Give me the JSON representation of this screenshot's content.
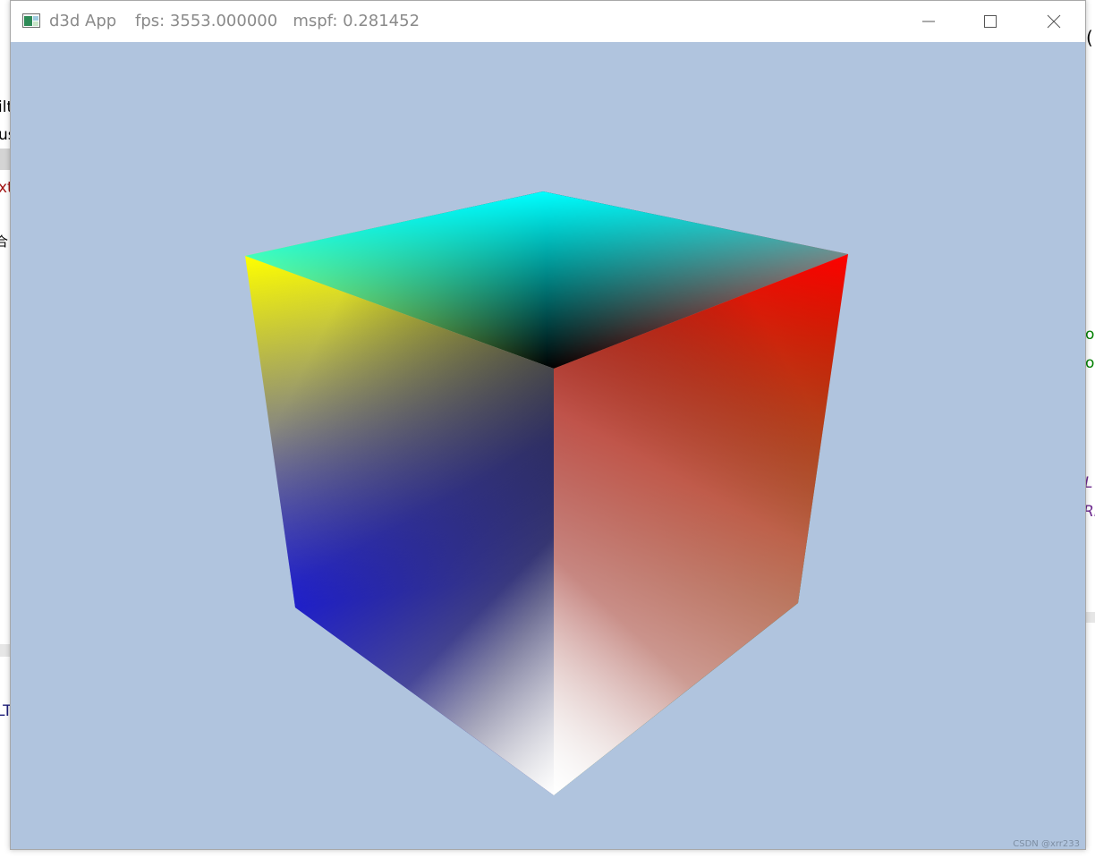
{
  "window": {
    "app_name": "d3d App",
    "stats": "fps: 3553.000000   mspf: 0.281452",
    "minimize_icon": "minimize-icon",
    "maximize_icon": "maximize-icon",
    "close_icon": "close-icon"
  },
  "scene": {
    "background_color": "#b0c4de",
    "object": "cube",
    "vertex_colors": {
      "top_back": "#00ffff",
      "top_left": "#ffff00",
      "top_right": "#ff0000",
      "center": "#000000",
      "bottom_left": "#0000ff",
      "bottom_right": "#008000",
      "bottom_front": "#ffffff"
    }
  },
  "watermark": "CSDN @xrr233",
  "background_fragments": {
    "left": [
      "ilt",
      "us",
      "xt",
      "合",
      "LT"
    ],
    "right": [
      "(",
      "o",
      "o",
      "L",
      "Rl"
    ]
  }
}
